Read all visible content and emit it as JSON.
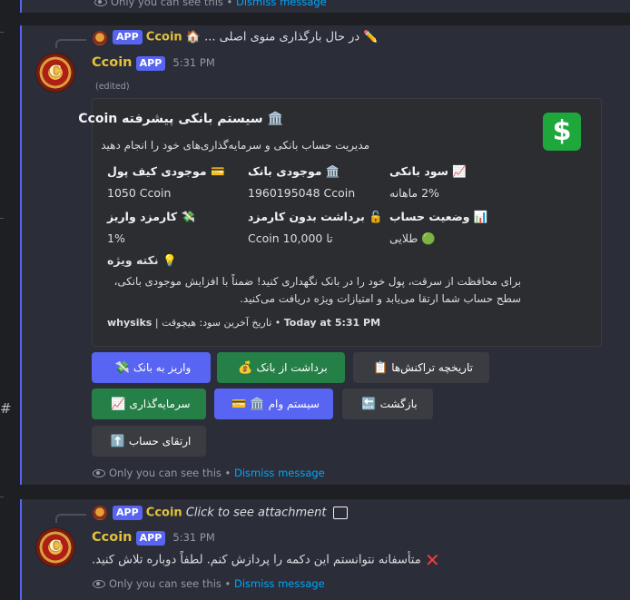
{
  "top_note": {
    "text": "Only you can see this",
    "dismiss": "Dismiss message"
  },
  "message1": {
    "reply": {
      "username": "Ccoin",
      "badge": "APP",
      "preview": "در حال بارگذاری منوی اصلی ...",
      "house_emoji": "🏠",
      "pen_emoji": "✏️"
    },
    "username": "Ccoin",
    "badge": "APP",
    "timestamp": "5:31 PM",
    "edited": "(edited)",
    "embed": {
      "title": "🏛️ سیستم بانکی پیشرفته Ccoin",
      "description": "مدیریت حساب بانکی و سرمایه‌گذاری‌های خود را انجام دهید",
      "icon": "dollar-icon",
      "fields": [
        {
          "name": "💳 موجودی کیف پول",
          "value": "1050 Ccoin"
        },
        {
          "name": "🏛️ موجودی بانک",
          "value": "1960195048 Ccoin"
        },
        {
          "name": "📈 سود بانکی",
          "value": "2% ماهانه"
        },
        {
          "name": "💸 کارمزد واریز",
          "value": "1%"
        },
        {
          "name": "🔓 برداشت بدون کارمزد",
          "value": "تا 10,000 Ccoin"
        },
        {
          "name": "📊 وضعیت حساب",
          "value": "🟢 طلایی"
        }
      ],
      "note_title": "💡 نکته ویژه",
      "note_body": "برای محافظت از سرقت، پول خود را در بانک نگهداری کنید! ضمناً با افزایش موجودی بانکی، سطح حساب شما ارتقا می‌یابد و امتیازات ویژه دریافت می‌کنید.",
      "footer_user": "whysiks",
      "footer_text": "تاریخ آخرین سود: هیچوقت",
      "footer_time": "Today at 5:31 PM"
    },
    "buttons": {
      "deposit": "واریز به بانک",
      "withdraw": "برداشت از بانک",
      "history": "تاریخچه تراکنش‌ها",
      "invest": "سرمایه‌گذاری",
      "loan": "سیستم وام",
      "back": "بازگشت",
      "upgrade": "ارتقای حساب"
    },
    "emojis": {
      "deposit": "💸",
      "withdraw": "💰",
      "history": "📋",
      "invest": "📈",
      "loan": "💳 🏛️",
      "back": "🔙",
      "upgrade": "⬆️"
    },
    "system_note": {
      "text": "Only you can see this",
      "dismiss": "Dismiss message"
    }
  },
  "message2": {
    "reply": {
      "username": "Ccoin",
      "badge": "APP",
      "preview": "Click to see attachment"
    },
    "username": "Ccoin",
    "badge": "APP",
    "timestamp": "5:31 PM",
    "text": "متأسفانه نتوانستم این دکمه را پردازش کنم. لطفاً دوباره تلاش کنید.",
    "system_note": {
      "text": "Only you can see this",
      "dismiss": "Dismiss message"
    }
  },
  "colors": {
    "accent": "#5865f2",
    "username": "#e3c13a",
    "success": "#248046",
    "link": "#00a8fc",
    "danger": "#f23f42"
  }
}
